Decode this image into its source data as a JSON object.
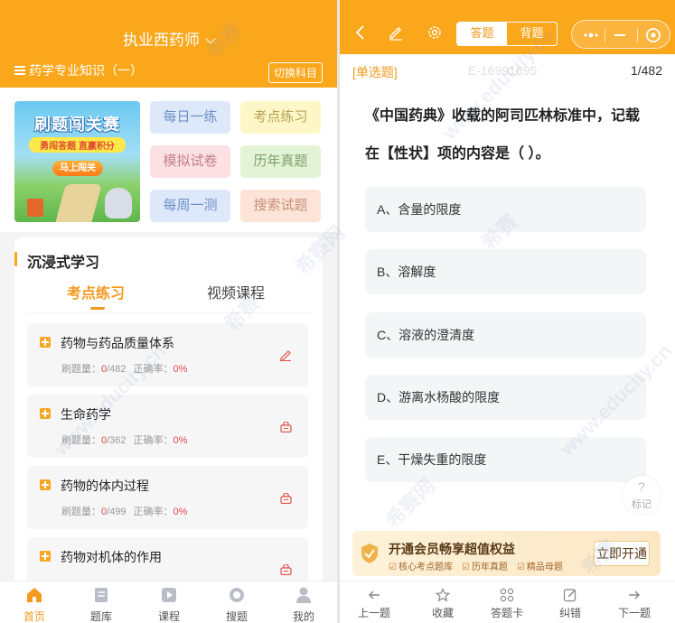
{
  "left": {
    "subject": "执业西药师",
    "course": "药学专业知识（一）",
    "switch_label": "切换科目",
    "banner": {
      "title": "刷题闯关赛",
      "subtitle": "勇闯答题 直赢积分",
      "button": "马上闯关"
    },
    "quick_links": [
      "每日一练",
      "考点练习",
      "模拟试卷",
      "历年真题",
      "每周一测",
      "搜索试题"
    ],
    "study_title": "沉浸式学习",
    "tabs": [
      "考点练习",
      "视频课程"
    ],
    "stats_labels": {
      "count": "刷题量：",
      "rate": "正确率："
    },
    "chapters": [
      {
        "name": "药物与药品质量体系",
        "done": "0",
        "total": "/482",
        "rate": "0%",
        "icon": "edit-icon"
      },
      {
        "name": "生命药学",
        "done": "0",
        "total": "/362",
        "rate": "0%",
        "icon": "lock-icon"
      },
      {
        "name": "药物的体内过程",
        "done": "0",
        "total": "/499",
        "rate": "0%",
        "icon": "lock-icon"
      },
      {
        "name": "药物对机体的作用",
        "icon": "lock-icon"
      }
    ],
    "nav": [
      {
        "label": "首页",
        "icon": "home-icon",
        "active": true
      },
      {
        "label": "题库",
        "icon": "book-icon",
        "active": false
      },
      {
        "label": "课程",
        "icon": "play-icon",
        "active": false
      },
      {
        "label": "搜题",
        "icon": "search-icon",
        "active": false
      },
      {
        "label": "我的",
        "icon": "user-icon",
        "active": false
      }
    ]
  },
  "right": {
    "modes": [
      "答题",
      "背题"
    ],
    "active_mode": "答题",
    "question_type": "[单选题]",
    "question_id": "E-16991695",
    "progress": "1/482",
    "question": "《中国药典》收载的阿司匹林标准中，记载在【性状】项的内容是（ ）。",
    "options": [
      "A、含量的限度",
      "B、溶解度",
      "C、溶液的澄清度",
      "D、游离水杨酸的限度",
      "E、干燥失重的限度"
    ],
    "mark": {
      "symbol": "?",
      "label": "标记"
    },
    "vip": {
      "title": "开通会员畅享超值权益",
      "perks": [
        "核心考点题库",
        "历年真题",
        "精品母题"
      ],
      "button": "立即开通"
    },
    "nav": [
      {
        "label": "上一题",
        "icon": "arrow-left-icon"
      },
      {
        "label": "收藏",
        "icon": "star-icon"
      },
      {
        "label": "答题卡",
        "icon": "grid-icon"
      },
      {
        "label": "纠错",
        "icon": "edit-icon"
      },
      {
        "label": "下一题",
        "icon": "arrow-right-icon"
      }
    ]
  },
  "watermark": [
    "希赛",
    "www.educity.cn",
    "希赛网"
  ],
  "colors": {
    "brand": "#fba71c",
    "accent_text": "#f39a1f",
    "correct_rate_red": "#e34a4a"
  }
}
